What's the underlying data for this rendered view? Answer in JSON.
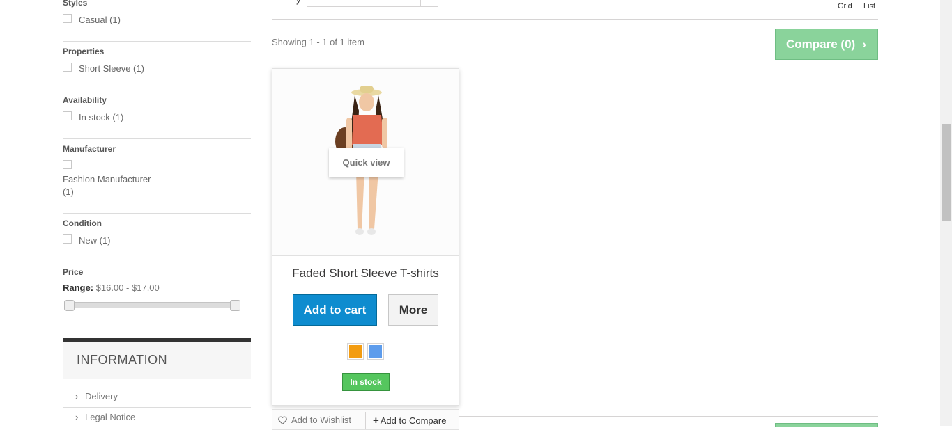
{
  "sidebar": {
    "styles": {
      "title": "Styles",
      "option": "Casual (1)"
    },
    "properties": {
      "title": "Properties",
      "option": "Short Sleeve (1)"
    },
    "availability": {
      "title": "Availability",
      "option": "In stock (1)"
    },
    "manufacturer": {
      "title": "Manufacturer",
      "option_line1": "Fashion Manufacturer",
      "option_line2": "(1)"
    },
    "condition": {
      "title": "Condition",
      "option": "New (1)"
    },
    "price": {
      "title": "Price",
      "range_label": "Range:",
      "range_value": "$16.00 - $17.00",
      "min_fraction": 0.0,
      "max_fraction": 1.0
    },
    "information": {
      "title": "INFORMATION",
      "items": [
        "Delivery",
        "Legal Notice"
      ]
    }
  },
  "toolbar": {
    "grid_label": "Grid",
    "list_label": "List",
    "sort_value": ""
  },
  "listing": {
    "showing_text": "Showing 1 - 1 of 1 item",
    "compare_label": "Compare (0)"
  },
  "product": {
    "name": "Faded Short Sleeve T-shirts",
    "quick_view": "Quick view",
    "add_to_cart": "Add to cart",
    "more": "More",
    "swatches": [
      "#f39c11",
      "#5d9cec"
    ],
    "stock": "In stock",
    "wishlist": "Add to Wishlist",
    "add_to_compare": "Add to Compare"
  },
  "colors": {
    "compare_green": "#8ad39b",
    "cart_blue": "#0e8ccf",
    "stock_green": "#55c65e"
  }
}
